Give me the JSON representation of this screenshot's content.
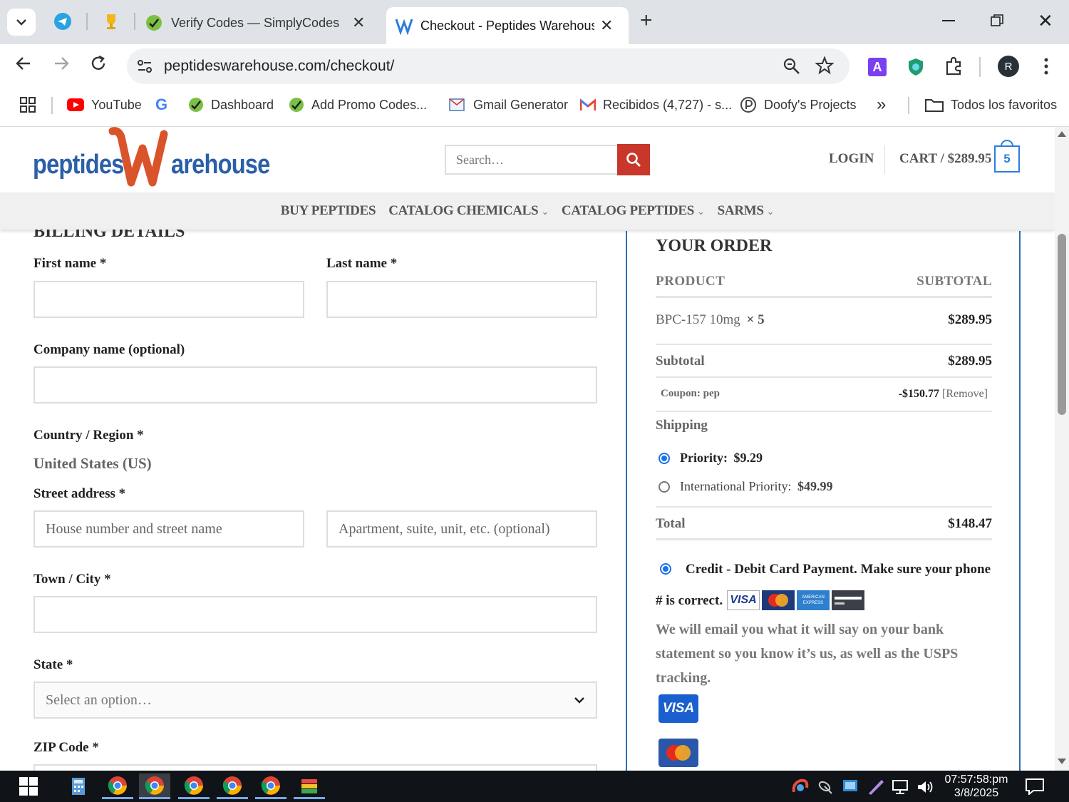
{
  "browser": {
    "tabs": [
      {
        "title": "Verify Codes — SimplyCodes"
      },
      {
        "title": "Checkout - Peptides Warehouse"
      }
    ],
    "url": "peptideswarehouse.com/checkout/",
    "profile_initial": "R",
    "bookmarks": [
      {
        "label": "YouTube"
      },
      {
        "label": "Dashboard"
      },
      {
        "label": "Add Promo Codes..."
      },
      {
        "label": "Gmail Generator"
      },
      {
        "label": "Recibidos (4,727) - s..."
      },
      {
        "label": "Doofy's Projects"
      }
    ],
    "all_bookmarks": "Todos los favoritos",
    "overflow": "»"
  },
  "site": {
    "logo": {
      "part1": "peptides",
      "part2": "arehouse"
    },
    "search_placeholder": "Search…",
    "login": "LOGIN",
    "cart": "CART / $289.95",
    "cart_count": "5",
    "nav": [
      {
        "label": "BUY PEPTIDES",
        "dropdown": false
      },
      {
        "label": "CATALOG CHEMICALS",
        "dropdown": true
      },
      {
        "label": "CATALOG PEPTIDES",
        "dropdown": true
      },
      {
        "label": "SARMS",
        "dropdown": true
      }
    ]
  },
  "billing": {
    "heading": "BILLING DETAILS",
    "first_name": "First name *",
    "last_name": "Last name *",
    "company": "Company name (optional)",
    "country_label": "Country / Region *",
    "country_value": "United States (US)",
    "street_label": "Street address *",
    "street_placeholder": "House number and street name",
    "apt_placeholder": "Apartment, suite, unit, etc. (optional)",
    "city_label": "Town / City *",
    "state_label": "State *",
    "state_placeholder": "Select an option…",
    "zip_label": "ZIP Code *"
  },
  "order": {
    "heading": "YOUR ORDER",
    "col_product": "PRODUCT",
    "col_subtotal": "SUBTOTAL",
    "item_name": "BPC-157 10mg",
    "item_qty": "× 5",
    "item_price": "$289.95",
    "subtotal_label": "Subtotal",
    "subtotal_value": "$289.95",
    "coupon_label": "Coupon: pep",
    "coupon_value": "-$150.77",
    "coupon_remove": "[Remove]",
    "shipping_label": "Shipping",
    "shipping_options": [
      {
        "label": "Priority:",
        "price": "$9.29",
        "selected": true
      },
      {
        "label": "International Priority:",
        "price": "$49.99",
        "selected": false
      }
    ],
    "total_label": "Total",
    "total_value": "$148.47",
    "payment_title_1": "Credit - Debit Card Payment. Make sure your phone",
    "payment_title_2": "# is correct.",
    "payment_desc": "We will email you what it will say on your bank statement so you know it’s us, as well as the USPS tracking.",
    "card_logos": [
      "VISA",
      "MasterCard",
      "AMERICAN EXPRESS",
      "card"
    ],
    "visa_big": "VISA"
  },
  "taskbar": {
    "time": "07:57:58:pm",
    "date": "3/8/2025"
  },
  "colors": {
    "brand_blue": "#2b5fa8",
    "brand_orange": "#d9532b",
    "search_btn": "#c8372a",
    "order_border": "#2d6db5",
    "radio_blue": "#1a73e8"
  }
}
